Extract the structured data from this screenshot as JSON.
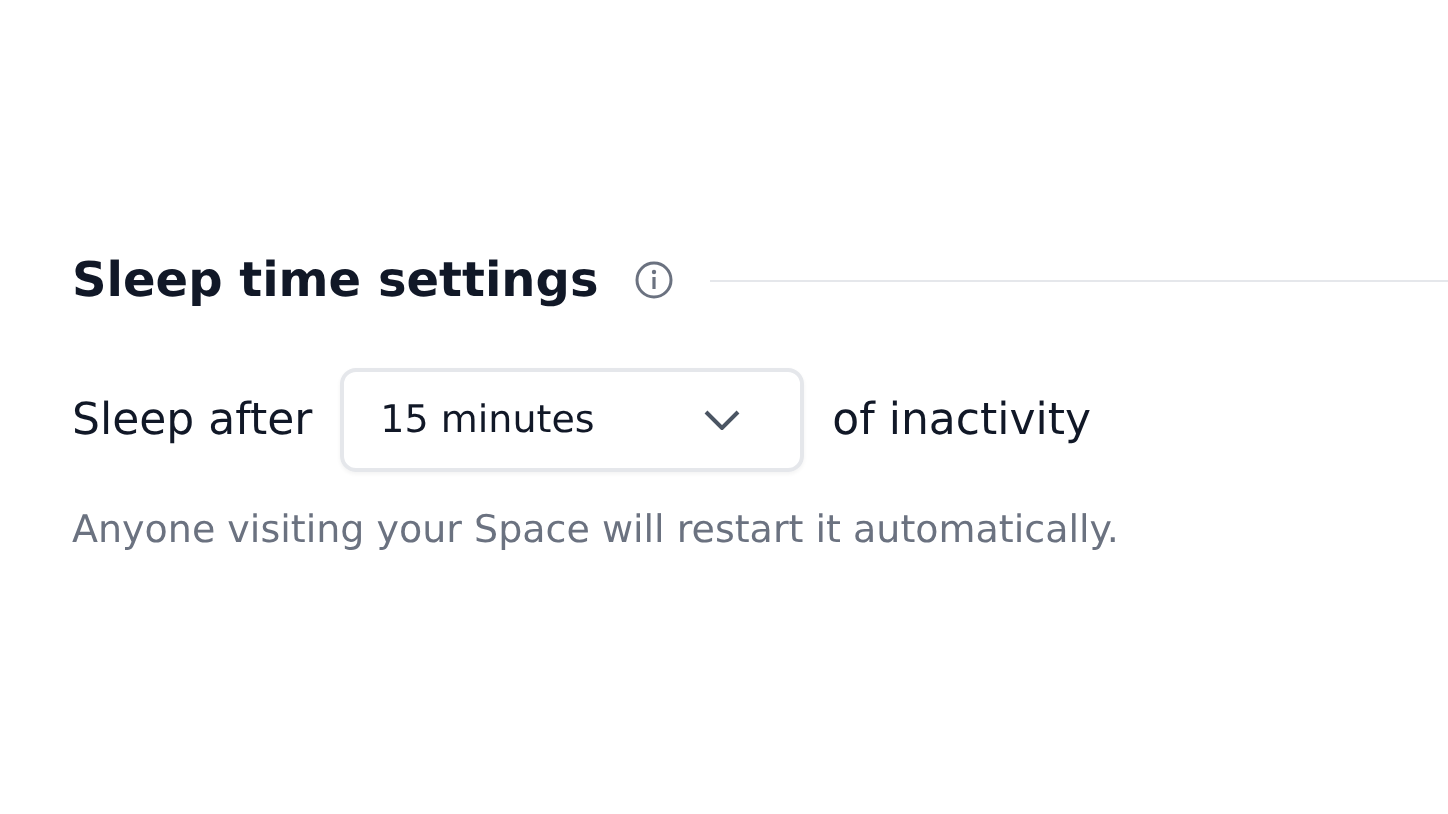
{
  "section": {
    "title": "Sleep time settings"
  },
  "row": {
    "label_before": "Sleep after",
    "select": {
      "value": "15 minutes"
    },
    "label_after": "of inactivity"
  },
  "hint": "Anyone visiting your Space will restart it automatically."
}
